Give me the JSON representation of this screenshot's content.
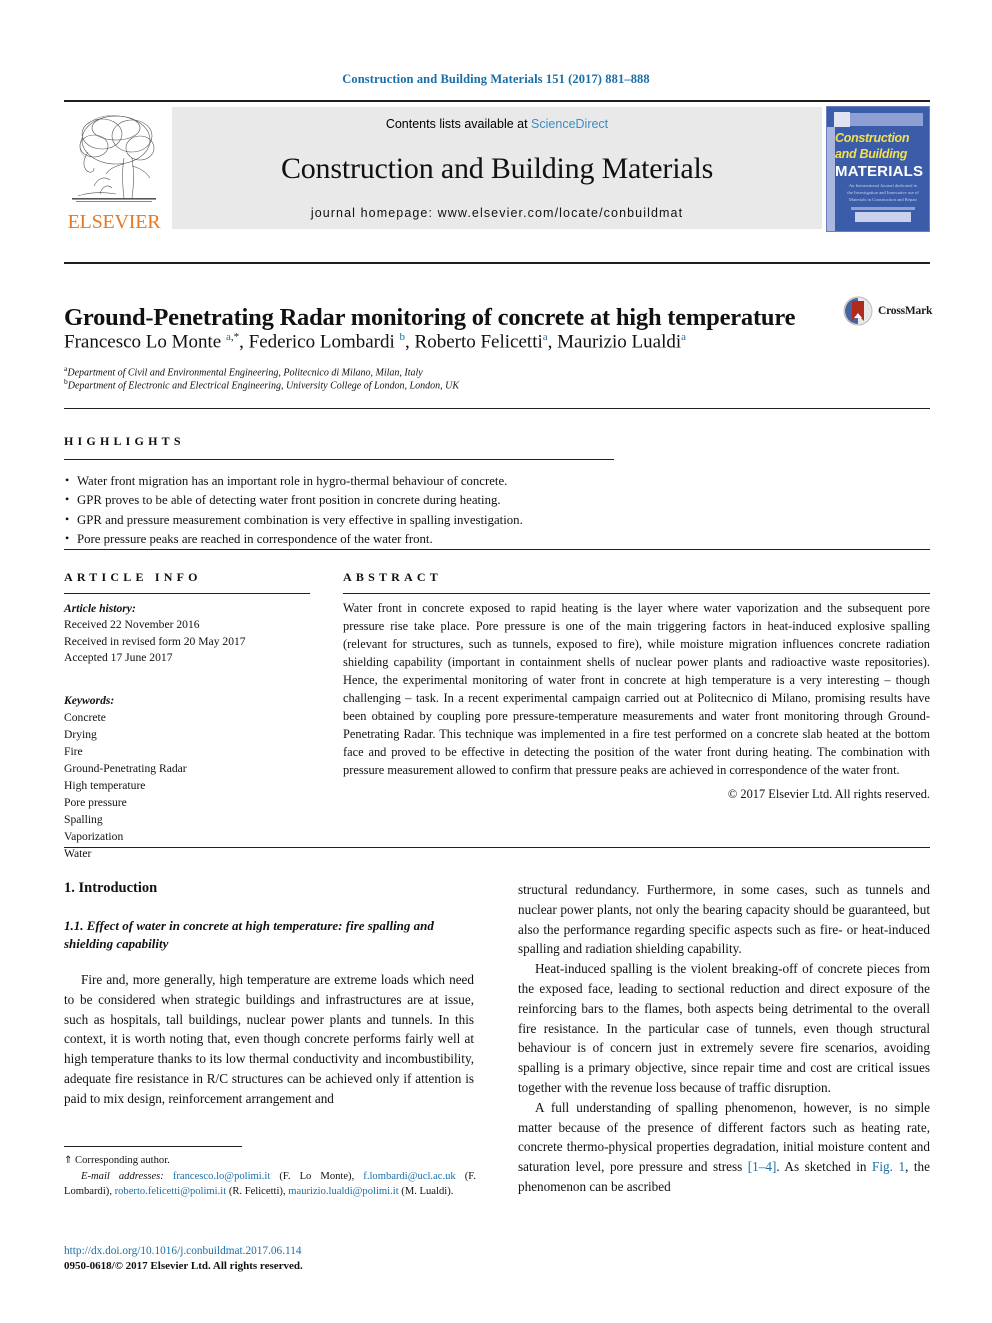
{
  "running_head": "Construction and Building Materials 151 (2017) 881–888",
  "masthead": {
    "contents_prefix": "Contents lists available at ",
    "sciencedirect": "ScienceDirect",
    "journal_title": "Construction and Building Materials",
    "homepage": "journal homepage: www.elsevier.com/locate/conbuildmat",
    "publisher_wordmark": "ELSEVIER",
    "cover": {
      "line1": "Construction",
      "line2": "and Building",
      "line3": "MATERIALS",
      "blurb": "An International Journal dedicated to the Investigation and Innovative use of Materials in Construction and Repair"
    }
  },
  "article": {
    "title": "Ground-Penetrating Radar monitoring of concrete at high temperature",
    "crossmark_label": "CrossMark",
    "authors_html": "Francesco Lo Monte <sup class=\"sup\">a</sup><sup class=\"sup-star\">,*</sup>, Federico Lombardi <sup class=\"sup\">b</sup>, Roberto Felicetti<sup class=\"sup\">a</sup>, Maurizio Lualdi<sup class=\"sup\">a</sup>",
    "affiliation_a": "Department of Civil and Environmental Engineering, Politecnico di Milano, Milan, Italy",
    "affiliation_b": "Department of Electronic and Electrical Engineering, University College of London, London, UK",
    "affiliation_a_label": "a",
    "affiliation_b_label": "b"
  },
  "highlights": {
    "heading": "HIGHLIGHTS",
    "items": [
      "Water front migration has an important role in hygro-thermal behaviour of concrete.",
      "GPR proves to be able of detecting water front position in concrete during heating.",
      "GPR and pressure measurement combination is very effective in spalling investigation.",
      "Pore pressure peaks are reached in correspondence of the water front."
    ]
  },
  "article_info": {
    "heading": "ARTICLE INFO",
    "history_label": "Article history:",
    "history": [
      "Received 22 November 2016",
      "Received in revised form 20 May 2017",
      "Accepted 17 June 2017"
    ],
    "keywords_label": "Keywords:",
    "keywords": [
      "Concrete",
      "Drying",
      "Fire",
      "Ground-Penetrating Radar",
      "High temperature",
      "Pore pressure",
      "Spalling",
      "Vaporization",
      "Water"
    ]
  },
  "abstract": {
    "heading": "ABSTRACT",
    "text": "Water front in concrete exposed to rapid heating is the layer where water vaporization and the subsequent pore pressure rise take place. Pore pressure is one of the main triggering factors in heat-induced explosive spalling (relevant for structures, such as tunnels, exposed to fire), while moisture migration influences concrete radiation shielding capability (important in containment shells of nuclear power plants and radioactive waste repositories). Hence, the experimental monitoring of water front in concrete at high temperature is a very interesting – though challenging – task. In a recent experimental campaign carried out at Politecnico di Milano, promising results have been obtained by coupling pore pressure-temperature measurements and water front monitoring through Ground-Penetrating Radar. This technique was implemented in a fire test performed on a concrete slab heated at the bottom face and proved to be effective in detecting the position of the water front during heating. The combination with pressure measurement allowed to confirm that pressure peaks are achieved in correspondence of the water front.",
    "copyright": "© 2017 Elsevier Ltd. All rights reserved."
  },
  "body": {
    "section_number_title": "1. Introduction",
    "subsection_title": "1.1. Effect of water in concrete at high temperature: fire spalling and shielding capability",
    "left_paragraph_1": "Fire and, more generally, high temperature are extreme loads which need to be considered when strategic buildings and infrastructures are at issue, such as hospitals, tall buildings, nuclear power plants and tunnels. In this context, it is worth noting that, even though concrete performs fairly well at high temperature thanks to its low thermal conductivity and incombustibility, adequate fire resistance in R/C structures can be achieved only if attention is paid to mix design, reinforcement arrangement and",
    "right_paragraph_1": "structural redundancy. Furthermore, in some cases, such as tunnels and nuclear power plants, not only the bearing capacity should be guaranteed, but also the performance regarding specific aspects such as fire- or heat-induced spalling and radiation shielding capability.",
    "right_paragraph_2": "Heat-induced spalling is the violent breaking-off of concrete pieces from the exposed face, leading to sectional reduction and direct exposure of the reinforcing bars to the flames, both aspects being detrimental to the overall fire resistance. In the particular case of tunnels, even though structural behaviour is of concern just in extremely severe fire scenarios, avoiding spalling is a primary objective, since repair time and cost are critical issues together with the revenue loss because of traffic disruption.",
    "right_paragraph_3_pre": "A full understanding of spalling phenomenon, however, is no simple matter because of the presence of different factors such as heating rate, concrete thermo-physical properties degradation, initial moisture content and saturation level, pore pressure and stress ",
    "right_paragraph_3_ref1": "[1–4]",
    "right_paragraph_3_mid": ". As sketched in ",
    "right_paragraph_3_ref2": "Fig. 1",
    "right_paragraph_3_post": ", the phenomenon can be ascribed"
  },
  "footnotes": {
    "corresponding_marker": "⇑",
    "corresponding_text": "Corresponding author.",
    "email_label": "E-mail addresses:",
    "emails": [
      {
        "address": "francesco.lo@polimi.it",
        "name": "(F. Lo Monte)"
      },
      {
        "address": "f.lombardi@ucl.ac.uk",
        "name": "(F. Lombardi)"
      },
      {
        "address": "roberto.felicetti@polimi.it",
        "name": "(R. Felicetti)"
      },
      {
        "address": "maurizio.lualdi@polimi.it",
        "name": "(M. Lualdi)"
      }
    ],
    "doi": "http://dx.doi.org/10.1016/j.conbuildmat.2017.06.114",
    "issn_line": "0950-0618/© 2017 Elsevier Ltd. All rights reserved."
  },
  "colors": {
    "link_blue": "#1a6ea8",
    "sd_blue": "#3a8dc4",
    "elsevier_orange": "#e87722",
    "cover_blue": "#3b5ca8",
    "cover_yellow": "#f4e04a"
  }
}
